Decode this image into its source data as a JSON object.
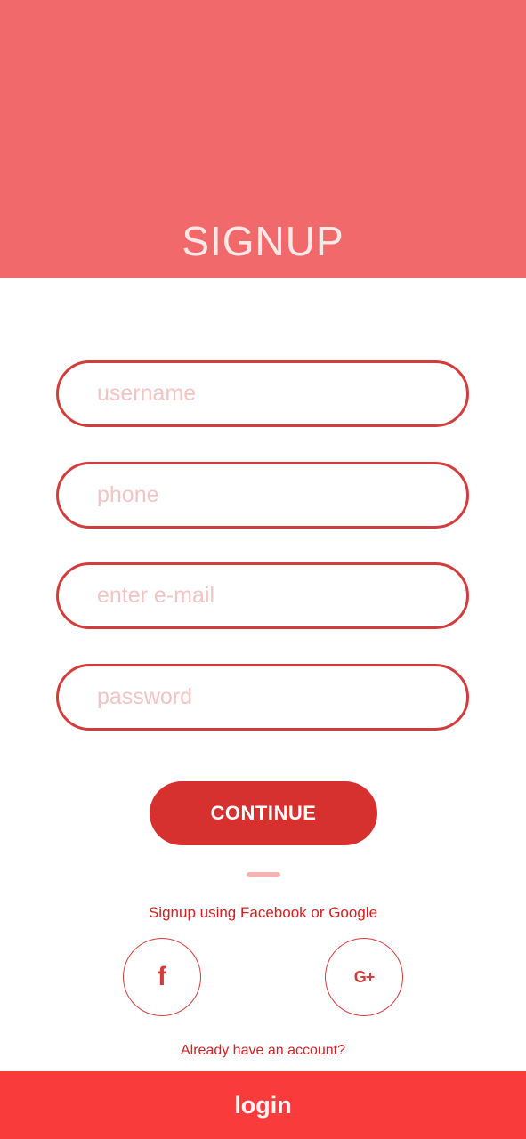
{
  "colors": {
    "header_bg": "#f2696c",
    "accent": "#d6302f",
    "field_border": "#d23c3c",
    "placeholder": "#f2c4c4",
    "login_bar_bg": "#fa3b3b",
    "link_text": "#d31f1f"
  },
  "header": {
    "title": "SIGNUP"
  },
  "form": {
    "fields": [
      {
        "name": "username",
        "placeholder": "username",
        "value": ""
      },
      {
        "name": "phone",
        "placeholder": "phone",
        "value": ""
      },
      {
        "name": "email",
        "placeholder": "enter e-mail",
        "value": ""
      },
      {
        "name": "password",
        "placeholder": "password",
        "value": ""
      }
    ],
    "continue_label": "CONTINUE"
  },
  "social": {
    "text": "Signup using Facebook or Google",
    "facebook": {
      "icon": "facebook-icon",
      "glyph": "f"
    },
    "google": {
      "icon": "google-plus-icon",
      "glyph": "G+"
    }
  },
  "footer": {
    "account_text": "Already have an account?",
    "login_label": "login"
  }
}
